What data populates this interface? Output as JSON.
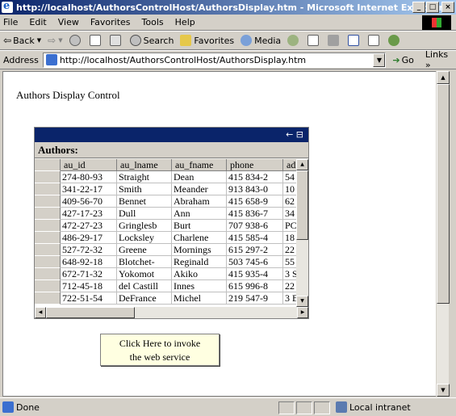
{
  "window": {
    "title": "http://localhost/AuthorsControlHost/AuthorsDisplay.htm - Microsoft Internet Explorer",
    "buttons": [
      "_",
      "□",
      "×"
    ]
  },
  "menu": [
    "File",
    "Edit",
    "View",
    "Favorites",
    "Tools",
    "Help"
  ],
  "toolbar": {
    "back": "Back",
    "search": "Search",
    "favorites": "Favorites",
    "media": "Media"
  },
  "address": {
    "label": "Address",
    "url": "http://localhost/AuthorsControlHost/AuthorsDisplay.htm",
    "go": "Go",
    "links": "Links »"
  },
  "page": {
    "heading": "Authors Display Control",
    "grid": {
      "caption_icons": "← ⊟",
      "title": "Authors:",
      "columns": [
        "au_id",
        "au_lname",
        "au_fname",
        "phone",
        "ad"
      ],
      "rows": [
        [
          "274-80-93",
          "Straight",
          "Dean",
          "415 834-2",
          "54"
        ],
        [
          "341-22-17",
          "Smith",
          "Meander",
          "913 843-0",
          "10"
        ],
        [
          "409-56-70",
          "Bennet",
          "Abraham",
          "415 658-9",
          "62"
        ],
        [
          "427-17-23",
          "Dull",
          "Ann",
          "415 836-7",
          "34"
        ],
        [
          "472-27-23",
          "Gringlesb",
          "Burt",
          "707 938-6",
          "PC"
        ],
        [
          "486-29-17",
          "Locksley",
          "Charlene",
          "415 585-4",
          "18"
        ],
        [
          "527-72-32",
          "Greene",
          "Mornings",
          "615 297-2",
          "22"
        ],
        [
          "648-92-18",
          "Blotchet-",
          "Reginald",
          "503 745-6",
          "55"
        ],
        [
          "672-71-32",
          "Yokomot",
          "Akiko",
          "415 935-4",
          "3 S"
        ],
        [
          "712-45-18",
          "del Castill",
          "Innes",
          "615 996-8",
          "22"
        ],
        [
          "722-51-54",
          "DeFrance",
          "Michel",
          "219 547-9",
          "3 B"
        ]
      ]
    },
    "invoke_button": [
      "Click Here to invoke",
      "the web service"
    ]
  },
  "status": {
    "text": "Done",
    "zone": "Local intranet"
  }
}
